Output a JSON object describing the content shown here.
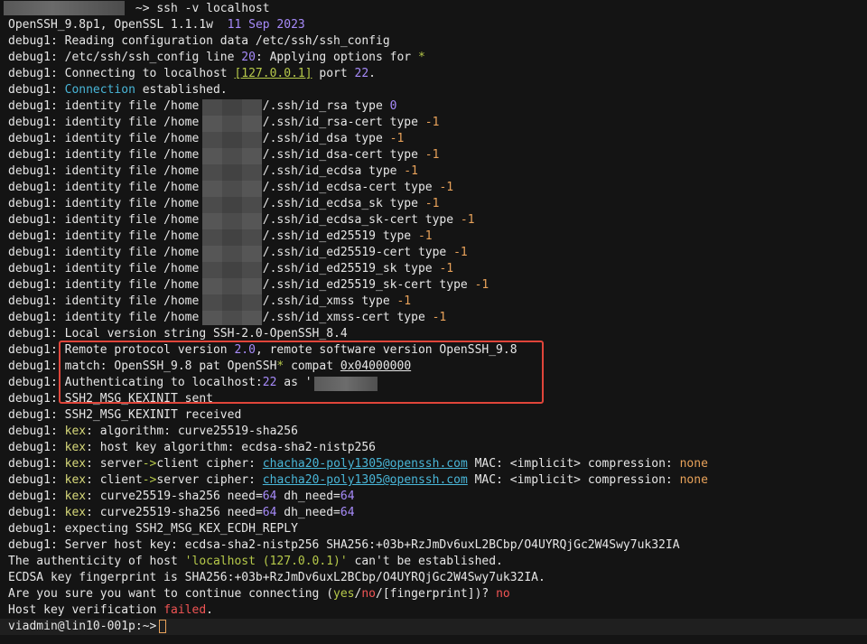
{
  "lines": [
    {
      "segs": [
        {
          "t": "                  ~> ssh -v localhost"
        }
      ]
    },
    {
      "segs": [
        {
          "t": "OpenSSH_9.8p1, OpenSSL 1.1.1w  "
        },
        {
          "t": "11 Sep 2023",
          "c": "purple"
        }
      ]
    },
    {
      "segs": [
        {
          "t": "debug1: Reading configuration data /etc/ssh/ssh_config"
        }
      ]
    },
    {
      "segs": [
        {
          "t": "debug1: /etc/ssh/ssh_config line "
        },
        {
          "t": "20",
          "c": "purple"
        },
        {
          "t": ": Applying options for "
        },
        {
          "t": "*",
          "c": "lime"
        }
      ]
    },
    {
      "segs": [
        {
          "t": "debug1: Connecting to localhost "
        },
        {
          "t": "[127.0.0.1]",
          "c": "lime-ul"
        },
        {
          "t": " port "
        },
        {
          "t": "22",
          "c": "purple"
        },
        {
          "t": "."
        }
      ]
    },
    {
      "segs": [
        {
          "t": "debug1: "
        },
        {
          "t": "Connection",
          "c": "cyan-plain"
        },
        {
          "t": " established."
        }
      ]
    },
    {
      "segs": [
        {
          "t": "debug1: identity file /home         /.ssh/id_rsa type "
        },
        {
          "t": "0",
          "c": "purple"
        }
      ]
    },
    {
      "segs": [
        {
          "t": "debug1: identity file /home         /.ssh/id_rsa-cert type "
        },
        {
          "t": "-1",
          "c": "orange"
        }
      ]
    },
    {
      "segs": [
        {
          "t": "debug1: identity file /home         /.ssh/id_dsa type "
        },
        {
          "t": "-1",
          "c": "orange"
        }
      ]
    },
    {
      "segs": [
        {
          "t": "debug1: identity file /home         /.ssh/id_dsa-cert type "
        },
        {
          "t": "-1",
          "c": "orange"
        }
      ]
    },
    {
      "segs": [
        {
          "t": "debug1: identity file /home         /.ssh/id_ecdsa type "
        },
        {
          "t": "-1",
          "c": "orange"
        }
      ]
    },
    {
      "segs": [
        {
          "t": "debug1: identity file /home         /.ssh/id_ecdsa-cert type "
        },
        {
          "t": "-1",
          "c": "orange"
        }
      ]
    },
    {
      "segs": [
        {
          "t": "debug1: identity file /home         /.ssh/id_ecdsa_sk type "
        },
        {
          "t": "-1",
          "c": "orange"
        }
      ]
    },
    {
      "segs": [
        {
          "t": "debug1: identity file /home         /.ssh/id_ecdsa_sk-cert type "
        },
        {
          "t": "-1",
          "c": "orange"
        }
      ]
    },
    {
      "segs": [
        {
          "t": "debug1: identity file /home         /.ssh/id_ed25519 type "
        },
        {
          "t": "-1",
          "c": "orange"
        }
      ]
    },
    {
      "segs": [
        {
          "t": "debug1: identity file /home         /.ssh/id_ed25519-cert type "
        },
        {
          "t": "-1",
          "c": "orange"
        }
      ]
    },
    {
      "segs": [
        {
          "t": "debug1: identity file /home         /.ssh/id_ed25519_sk type "
        },
        {
          "t": "-1",
          "c": "orange"
        }
      ]
    },
    {
      "segs": [
        {
          "t": "debug1: identity file /home         /.ssh/id_ed25519_sk-cert type "
        },
        {
          "t": "-1",
          "c": "orange"
        }
      ]
    },
    {
      "segs": [
        {
          "t": "debug1: identity file /home         /.ssh/id_xmss type "
        },
        {
          "t": "-1",
          "c": "orange"
        }
      ]
    },
    {
      "segs": [
        {
          "t": "debug1: identity file /home         /.ssh/id_xmss-cert type "
        },
        {
          "t": "-1",
          "c": "orange"
        }
      ]
    },
    {
      "segs": [
        {
          "t": "debug1: Local version string SSH-2.0-OpenSSH_8.4"
        }
      ]
    },
    {
      "segs": [
        {
          "t": "debug1: Remote protocol version "
        },
        {
          "t": "2.0",
          "c": "purple"
        },
        {
          "t": ", remote software version OpenSSH_9.8"
        }
      ]
    },
    {
      "segs": [
        {
          "t": "debug1: match: OpenSSH_9.8 pat OpenSSH"
        },
        {
          "t": "*",
          "c": "lime"
        },
        {
          "t": " compat "
        },
        {
          "t": "0x04000000",
          "c": "white-ul"
        }
      ]
    },
    {
      "segs": [
        {
          "t": "debug1: Authenticating to localhost:"
        },
        {
          "t": "22",
          "c": "purple"
        },
        {
          "t": " as '"
        }
      ]
    },
    {
      "segs": [
        {
          "t": "debug1: SSH2_MSG_KEXINIT sent"
        }
      ]
    },
    {
      "segs": [
        {
          "t": "debug1: SSH2_MSG_KEXINIT received"
        }
      ]
    },
    {
      "segs": [
        {
          "t": "debug1: "
        },
        {
          "t": "kex",
          "c": "yellow"
        },
        {
          "t": ": algorithm: curve25519-sha256"
        }
      ]
    },
    {
      "segs": [
        {
          "t": "debug1: "
        },
        {
          "t": "kex",
          "c": "yellow"
        },
        {
          "t": ": host key algorithm: ecdsa-sha2-nistp256"
        }
      ]
    },
    {
      "segs": [
        {
          "t": "debug1: "
        },
        {
          "t": "kex",
          "c": "yellow"
        },
        {
          "t": ": server"
        },
        {
          "t": "->",
          "c": "lime"
        },
        {
          "t": "client cipher: "
        },
        {
          "t": "chacha20-poly1305@openssh.com",
          "c": "cyan"
        },
        {
          "t": " MAC: <implicit> compression: "
        },
        {
          "t": "none",
          "c": "orange"
        }
      ]
    },
    {
      "segs": [
        {
          "t": "debug1: "
        },
        {
          "t": "kex",
          "c": "yellow"
        },
        {
          "t": ": client"
        },
        {
          "t": "->",
          "c": "lime"
        },
        {
          "t": "server cipher: "
        },
        {
          "t": "chacha20-poly1305@openssh.com",
          "c": "cyan"
        },
        {
          "t": " MAC: <implicit> compression: "
        },
        {
          "t": "none",
          "c": "orange"
        }
      ]
    },
    {
      "segs": [
        {
          "t": "debug1: "
        },
        {
          "t": "kex",
          "c": "yellow"
        },
        {
          "t": ": curve25519-sha256 need="
        },
        {
          "t": "64",
          "c": "purple"
        },
        {
          "t": " dh_need="
        },
        {
          "t": "64",
          "c": "purple"
        }
      ]
    },
    {
      "segs": [
        {
          "t": "debug1: "
        },
        {
          "t": "kex",
          "c": "yellow"
        },
        {
          "t": ": curve25519-sha256 need="
        },
        {
          "t": "64",
          "c": "purple"
        },
        {
          "t": " dh_need="
        },
        {
          "t": "64",
          "c": "purple"
        }
      ]
    },
    {
      "segs": [
        {
          "t": "debug1: expecting SSH2_MSG_KEX_ECDH_REPLY"
        }
      ]
    },
    {
      "segs": [
        {
          "t": "debug1: Server host key: ecdsa-sha2-nistp256 SHA256:+03b+RzJmDv6uxL2BCbp/O4UYRQjGc2W4Swy7uk32IA"
        }
      ]
    },
    {
      "segs": [
        {
          "t": "The authenticity of host "
        },
        {
          "t": "'localhost (127.0.0.1)'",
          "c": "lime"
        },
        {
          "t": " can't be established."
        }
      ]
    },
    {
      "segs": [
        {
          "t": "ECDSA key fingerprint is SHA256:+03b+RzJmDv6uxL2BCbp/O4UYRQjGc2W4Swy7uk32IA."
        }
      ]
    },
    {
      "segs": [
        {
          "t": "Are you sure you want to continue connecting ("
        },
        {
          "t": "yes",
          "c": "lime"
        },
        {
          "t": "/"
        },
        {
          "t": "no",
          "c": "red"
        },
        {
          "t": "/[fingerprint])? "
        },
        {
          "t": "no",
          "c": "red"
        }
      ]
    },
    {
      "segs": [
        {
          "t": "Host key verification "
        },
        {
          "t": "failed",
          "c": "red"
        },
        {
          "t": "."
        }
      ]
    },
    {
      "segs": [
        {
          "t": "viadmin@lin10-001p:~>"
        }
      ],
      "cursor": true
    }
  ],
  "colors": {
    "background": "#141414",
    "text": "#e6e6e6",
    "purple": "#a78bfa",
    "orange": "#e8a25a",
    "lime": "#b6c94a",
    "red": "#f05454",
    "highlight": "#e0453a"
  }
}
